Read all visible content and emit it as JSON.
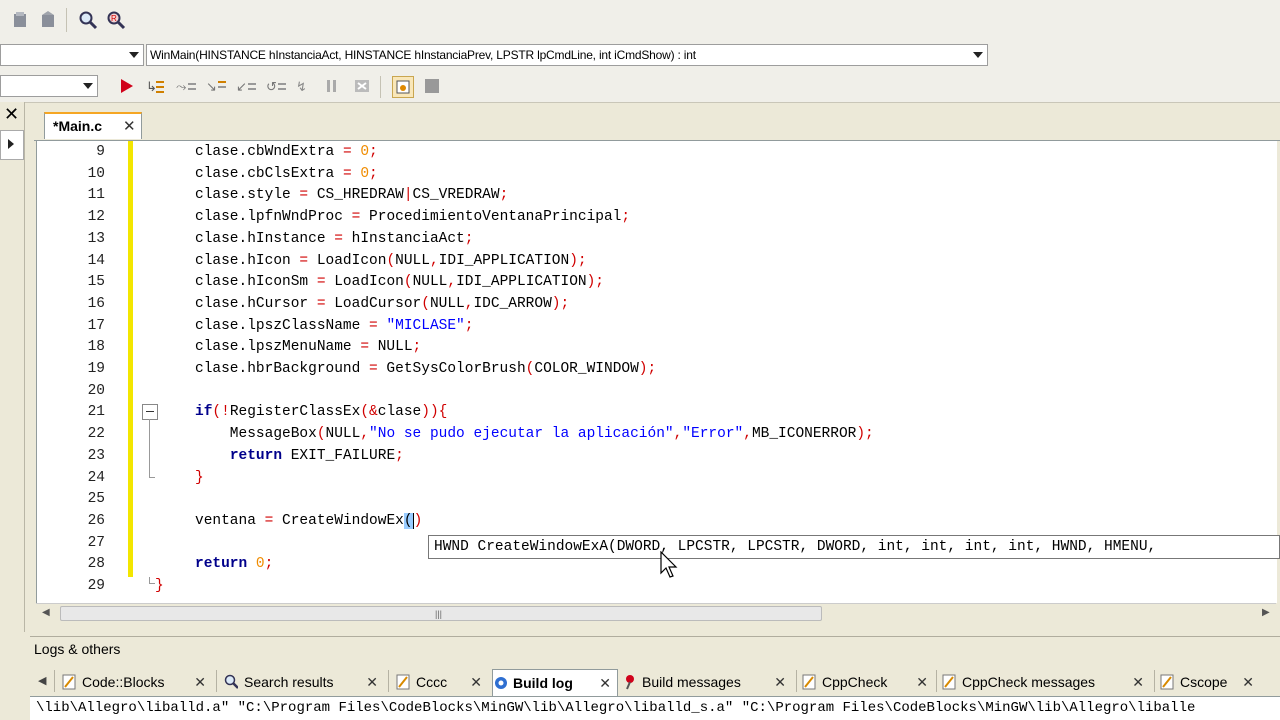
{
  "function_combo": {
    "value": "WinMain(HINSTANCE hInstanciaAct, HINSTANCE hInstanciaPrev, LPSTR lpCmdLine, int iCmdShow) : int"
  },
  "editor": {
    "tab_label": "*Main.c",
    "lines": [
      {
        "n": "9",
        "html": "<span>clase.cbWndExtra </span><span class='op'>=</span> <span class='num'>0</span><span class='op'>;</span>"
      },
      {
        "n": "10",
        "html": "<span>clase.cbClsExtra </span><span class='op'>=</span> <span class='num'>0</span><span class='op'>;</span>"
      },
      {
        "n": "11",
        "html": "<span>clase.style </span><span class='op'>=</span> CS_HREDRAW<span class='op'>|</span>CS_VREDRAW<span class='op'>;</span>"
      },
      {
        "n": "12",
        "html": "<span>clase.lpfnWndProc </span><span class='op'>=</span> ProcedimientoVentanaPrincipal<span class='op'>;</span>"
      },
      {
        "n": "13",
        "html": "<span>clase.hInstance </span><span class='op'>=</span> hInstanciaAct<span class='op'>;</span>"
      },
      {
        "n": "14",
        "html": "<span>clase.hIcon </span><span class='op'>=</span> LoadIcon<span class='op'>(</span>NULL<span class='op'>,</span>IDI_APPLICATION<span class='op'>);</span>"
      },
      {
        "n": "15",
        "html": "<span>clase.hIconSm </span><span class='op'>=</span> LoadIcon<span class='op'>(</span>NULL<span class='op'>,</span>IDI_APPLICATION<span class='op'>);</span>"
      },
      {
        "n": "16",
        "html": "<span>clase.hCursor </span><span class='op'>=</span> LoadCursor<span class='op'>(</span>NULL<span class='op'>,</span>IDC_ARROW<span class='op'>);</span>"
      },
      {
        "n": "17",
        "html": "<span>clase.lpszClassName </span><span class='op'>=</span> <span class='str'>\"MICLASE\"</span><span class='op'>;</span>"
      },
      {
        "n": "18",
        "html": "<span>clase.lpszMenuName </span><span class='op'>=</span> NULL<span class='op'>;</span>"
      },
      {
        "n": "19",
        "html": "<span>clase.hbrBackground </span><span class='op'>=</span> GetSysColorBrush<span class='op'>(</span>COLOR_WINDOW<span class='op'>);</span>"
      },
      {
        "n": "20",
        "html": ""
      },
      {
        "n": "21",
        "html": "<span class='kw'>if</span><span class='op'>(!</span>RegisterClassEx<span class='op'>(&amp;</span>clase<span class='op'>)){</span>"
      },
      {
        "n": "22",
        "html": "    MessageBox<span class='op'>(</span>NULL<span class='op'>,</span><span class='str'>\"No se pudo ejecutar la aplicación\"</span><span class='op'>,</span><span class='str'>\"Error\"</span><span class='op'>,</span>MB_ICONERROR<span class='op'>);</span>"
      },
      {
        "n": "23",
        "html": "    <span class='kw'>return</span> EXIT_FAILURE<span class='op'>;</span>"
      },
      {
        "n": "24",
        "html": "<span class='op'>}</span>"
      },
      {
        "n": "25",
        "html": ""
      },
      {
        "n": "26",
        "html": "ventana <span class='op'>=</span> CreateWindowEx<span style='background:#9cf;'>(</span><span style='border-left:1px solid #000;'></span><span class='op'>)</span>"
      },
      {
        "n": "27",
        "html": ""
      },
      {
        "n": "28",
        "html": "<span class='kw'>return</span> <span class='num'>0</span><span class='op'>;</span>"
      },
      {
        "n": "29",
        "html": "<span class='op'>}</span>"
      }
    ],
    "tooltip": "HWND CreateWindowExA(DWORD, LPCSTR, LPCSTR, DWORD, int, int, int, int, HWND, HMENU,"
  },
  "logs": {
    "header": "Logs & others",
    "tabs": [
      {
        "label": "Code::Blocks",
        "icon": "pencil-icon"
      },
      {
        "label": "Search results",
        "icon": "magnifier-icon"
      },
      {
        "label": "Cccc",
        "icon": "pencil-icon"
      },
      {
        "label": "Build log",
        "icon": "gear-icon"
      },
      {
        "label": "Build messages",
        "icon": "pin-icon"
      },
      {
        "label": "CppCheck",
        "icon": "pencil-icon"
      },
      {
        "label": "CppCheck messages",
        "icon": "pencil-icon"
      },
      {
        "label": "Cscope",
        "icon": "pencil-icon"
      }
    ],
    "output_line": "\\lib\\Allegro\\liballd.a\" \"C:\\Program Files\\CodeBlocks\\MinGW\\lib\\Allegro\\liballd_s.a\" \"C:\\Program Files\\CodeBlocks\\MinGW\\lib\\Allegro\\liballe"
  }
}
